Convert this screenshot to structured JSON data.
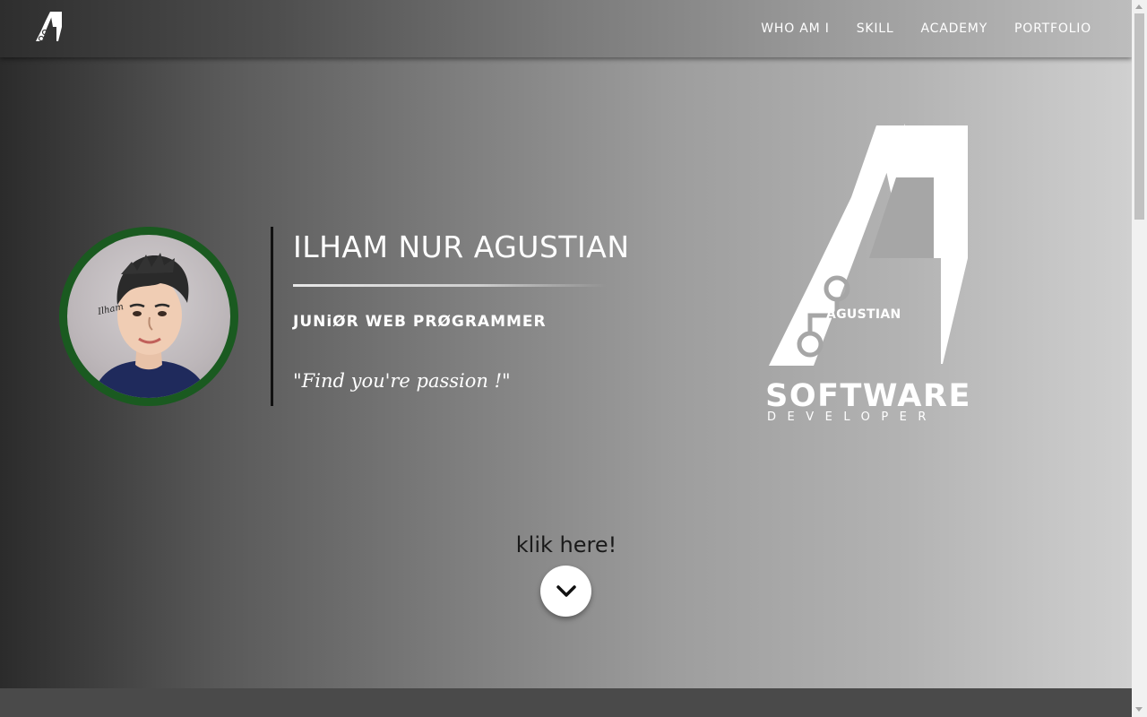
{
  "nav": {
    "items": [
      {
        "label": "WHO AM I"
      },
      {
        "label": "SKILL"
      },
      {
        "label": "ACADEMY"
      },
      {
        "label": "PORTFOLIO"
      }
    ]
  },
  "profile": {
    "name": "ILHAM NUR AGUSTIAN",
    "role": "JUNiØR WEB PRØGRAMMER",
    "quote": "\"Find you're passion !\"",
    "avatar_signature": "Ilham"
  },
  "brand": {
    "mark_text": "AGUSTIAN",
    "title": "SOFTWARE",
    "subtitle": "DEVELOPER"
  },
  "cta": {
    "label": "klik here!",
    "icon": "chevron-down-icon"
  },
  "colors": {
    "avatar_ring": "#1a5a20",
    "text": "#ffffff",
    "cta_label": "#1a1a1a",
    "next_section": "#4a4a4a"
  }
}
